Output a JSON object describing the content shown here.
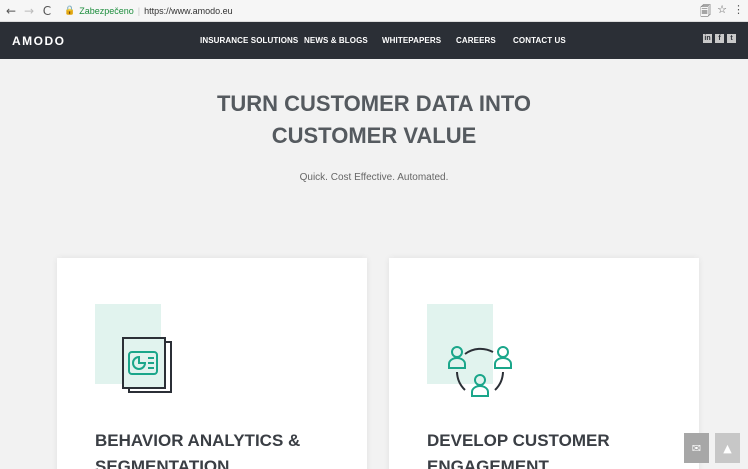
{
  "browser": {
    "back_icon": "back-arrow-icon",
    "back_glyph": "←",
    "forward_glyph": "→",
    "reload_glyph": "C",
    "lock_glyph": "🔒",
    "secure_label": "Zabezpečeno",
    "separator": "|",
    "url": "https://www.amodo.eu",
    "translate_glyph": "🗐",
    "star_glyph": "☆",
    "menu_glyph": "⋮"
  },
  "header": {
    "logo": "AMODO",
    "nav": [
      {
        "label": "INSURANCE SOLUTIONS"
      },
      {
        "label": "NEWS & BLOGS"
      },
      {
        "label": "WHITEPAPERS"
      },
      {
        "label": "CAREERS"
      },
      {
        "label": "CONTACT US"
      }
    ],
    "social": [
      {
        "icon": "linkedin-icon",
        "glyph": "in"
      },
      {
        "icon": "facebook-icon",
        "glyph": "f"
      },
      {
        "icon": "twitter-icon",
        "glyph": "t"
      }
    ],
    "bg_color": "#2b2f36"
  },
  "hero": {
    "title_line1": "TURN CUSTOMER DATA INTO",
    "title_line2": "CUSTOMER VALUE",
    "subtitle": "Quick. Cost Effective. Automated."
  },
  "cards": [
    {
      "title_line1": "BEHAVIOR ANALYTICS &",
      "title_line2": "SEGMENTATION",
      "icon": "analytics-report-icon"
    },
    {
      "title_line1": "DEVELOP CUSTOMER",
      "title_line2": "ENGAGEMENT",
      "icon": "customer-network-icon"
    }
  ],
  "floating": {
    "mail_glyph": "✉",
    "top_glyph": "▲"
  },
  "colors": {
    "accent_teal": "#1aa68a",
    "icon_bg": "#e1f3ee",
    "icon_dark": "#2b2f36"
  }
}
